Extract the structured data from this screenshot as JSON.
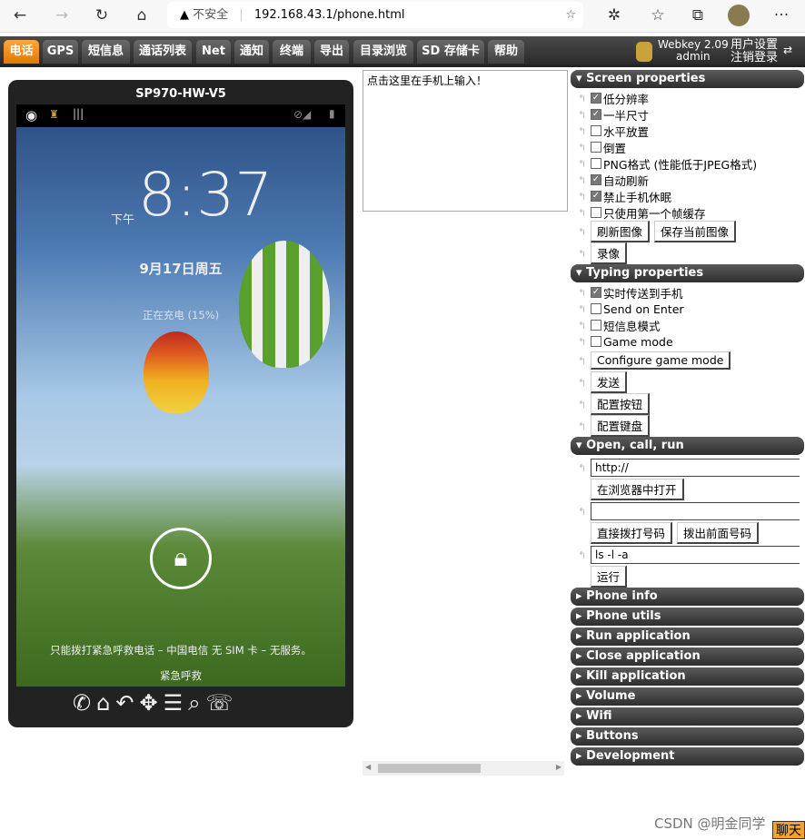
{
  "browser": {
    "security": "不安全",
    "url": "192.168.43.1/phone.html"
  },
  "menu": {
    "tabs": [
      "电话",
      "GPS",
      "短信息",
      "通话列表",
      "Net",
      "通知",
      "终端",
      "导出",
      "目录浏览",
      "SD 存储卡",
      "帮助"
    ],
    "active": "电话",
    "version": "Webkey 2.09",
    "user": "admin",
    "settings": "用户设置",
    "logout": "注销登录"
  },
  "phone": {
    "model": "SP970-HW-V5",
    "ampm": "下午",
    "time": "8:37",
    "date": "9月17日周五",
    "charging": "正在充电 (15%)",
    "emergency_info": "只能拨打紧急呼救电话 – 中国电信   无 SIM 卡 – 无服务。",
    "emergency": "紧急呼救"
  },
  "input": {
    "placeholder": "点击这里在手机上输入！"
  },
  "screen_props": {
    "title": "Screen properties",
    "items": [
      {
        "label": "低分辨率",
        "checked": true
      },
      {
        "label": "一半尺寸",
        "checked": true
      },
      {
        "label": "水平放置",
        "checked": false
      },
      {
        "label": "倒置",
        "checked": false
      },
      {
        "label": "PNG格式 (性能低于JPEG格式)",
        "checked": false
      },
      {
        "label": "自动刷新",
        "checked": true
      },
      {
        "label": "禁止手机休眠",
        "checked": true
      },
      {
        "label": "只使用第一个帧缓存",
        "checked": false
      }
    ],
    "refresh": "刷新图像",
    "save": "保存当前图像",
    "record": "录像"
  },
  "typing": {
    "title": "Typing properties",
    "items": [
      {
        "label": "实时传送到手机",
        "checked": true
      },
      {
        "label": "Send on Enter",
        "checked": false
      },
      {
        "label": "短信息模式",
        "checked": false
      },
      {
        "label": "Game mode",
        "checked": false
      }
    ],
    "configure_game": "Configure game mode",
    "send": "发送",
    "config_buttons": "配置按钮",
    "config_keyboard": "配置键盘"
  },
  "open": {
    "title": "Open, call, run",
    "url_value": "http://",
    "open_browser": "在浏览器中打开",
    "phone_value": "",
    "dial": "直接拨打号码",
    "dial_prev": "拨出前面号码",
    "cmd_value": "ls -l -a",
    "run": "运行"
  },
  "sections": [
    "Phone info",
    "Phone utils",
    "Run application",
    "Close application",
    "Kill application",
    "Volume",
    "Wifi",
    "Buttons",
    "Development"
  ],
  "watermark": "CSDN @明金同学",
  "chat": "聊天"
}
